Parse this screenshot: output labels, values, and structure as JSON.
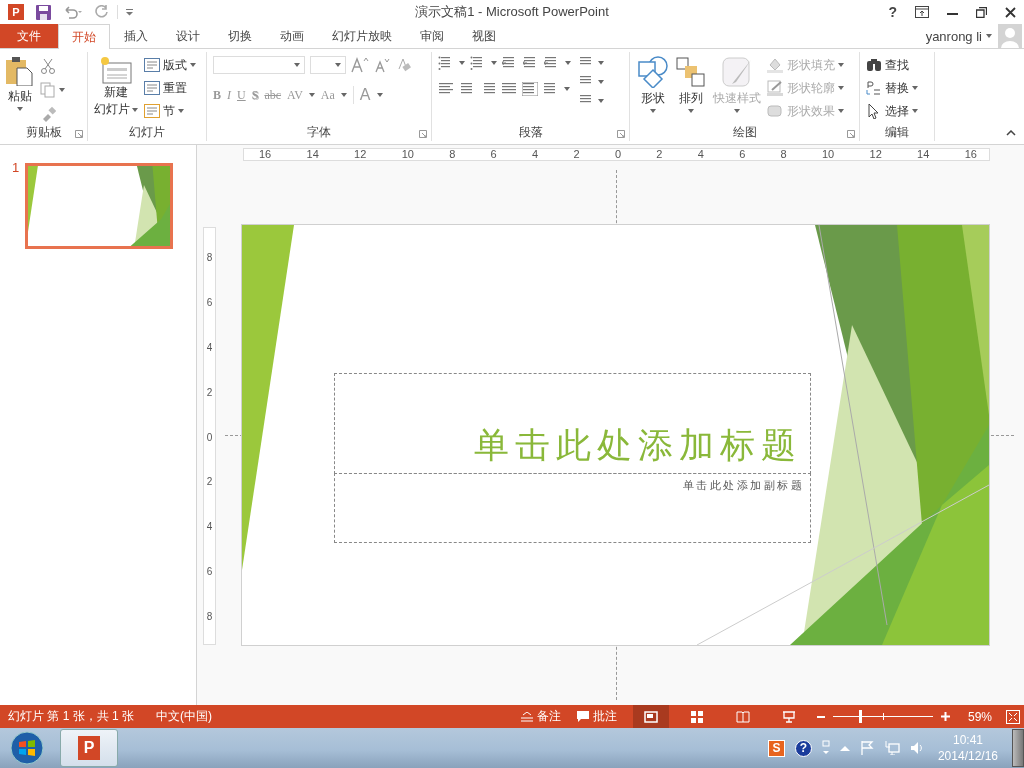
{
  "app_logo": "P",
  "title": "演示文稿1 - Microsoft PowerPoint",
  "help": "?",
  "tabs": [
    {
      "label": "文件",
      "kind": "file",
      "selected": false
    },
    {
      "label": "开始",
      "kind": "tab",
      "selected": true
    },
    {
      "label": "插入",
      "kind": "tab",
      "selected": false
    },
    {
      "label": "设计",
      "kind": "tab",
      "selected": false
    },
    {
      "label": "切换",
      "kind": "tab",
      "selected": false
    },
    {
      "label": "动画",
      "kind": "tab",
      "selected": false
    },
    {
      "label": "幻灯片放映",
      "kind": "tab",
      "selected": false
    },
    {
      "label": "审阅",
      "kind": "tab",
      "selected": false
    },
    {
      "label": "视图",
      "kind": "tab",
      "selected": false
    }
  ],
  "user": "yanrong li",
  "ribbon": {
    "clipboard": {
      "label": "剪贴板",
      "paste": "粘贴"
    },
    "slides": {
      "label": "幻灯片",
      "new_slide": [
        "新建",
        "幻灯片"
      ],
      "commands": [
        "版式",
        "重置",
        "节"
      ]
    },
    "font": {
      "label": "字体",
      "format": [
        "B",
        "I",
        "U",
        "S",
        "abc",
        "AV",
        "Aa",
        "A"
      ]
    },
    "paragraph": {
      "label": "段落"
    },
    "drawing": {
      "label": "绘图",
      "large": [
        {
          "label": "形状",
          "disabled": false
        },
        {
          "label": "排列",
          "disabled": false
        },
        {
          "label": "快速样式",
          "disabled": true
        }
      ],
      "small": [
        {
          "label": "形状填充",
          "disabled": true
        },
        {
          "label": "形状轮廓",
          "disabled": true
        },
        {
          "label": "形状效果",
          "disabled": true
        }
      ]
    },
    "editing": {
      "label": "编辑",
      "commands": [
        "查找",
        "替换",
        "选择"
      ]
    }
  },
  "thumbnails": [
    {
      "number": "1",
      "selected": true
    }
  ],
  "ruler": {
    "horizontal": [
      "16",
      "14",
      "12",
      "10",
      "8",
      "6",
      "4",
      "2",
      "0",
      "2",
      "4",
      "6",
      "8",
      "10",
      "12",
      "14",
      "16"
    ],
    "vertical": [
      "8",
      "6",
      "4",
      "2",
      "0",
      "2",
      "4",
      "6",
      "8"
    ]
  },
  "slide": {
    "title": "单击此处添加标题",
    "subtitle": "单击此处添加副标题"
  },
  "status": {
    "slide_info": "幻灯片 第 1 张，共 1 张",
    "language": "中文(中国)",
    "notes": "备注",
    "comments": "批注",
    "views": [
      {
        "kind": "normal",
        "selected": true
      },
      {
        "kind": "sorter",
        "selected": false
      },
      {
        "kind": "reading",
        "selected": false
      },
      {
        "kind": "slideshow",
        "selected": false
      }
    ],
    "zoom": {
      "level": 0.27
    },
    "zoom_label": "59%"
  },
  "taskbar": {
    "app_logo": "P",
    "tray": [
      {
        "kind": "ime",
        "label": "S"
      },
      {
        "kind": "help",
        "label": "?"
      }
    ],
    "time": "10:41",
    "date": "2014/12/16"
  }
}
